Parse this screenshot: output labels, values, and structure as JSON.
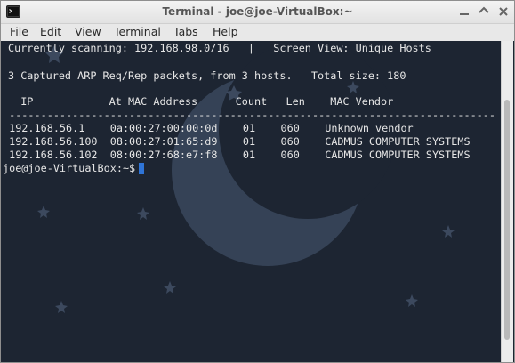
{
  "window": {
    "title": "Terminal - joe@joe-VirtualBox:~"
  },
  "menu": {
    "items": [
      "File",
      "Edit",
      "View",
      "Terminal",
      "Tabs",
      "Help"
    ]
  },
  "terminal": {
    "status_line": "Currently scanning: 192.168.98.0/16   |   Screen View: Unique Hosts",
    "summary_line": "3 Captured ARP Req/Rep packets, from 3 hosts.   Total size: 180",
    "header_line": "  IP            At MAC Address      Count   Len    MAC Vendor",
    "dash_line": " -----------------------------------------------------------------------------",
    "rows": [
      " 192.168.56.1    0a:00:27:00:00:0d    01    060    Unknown vendor",
      " 192.168.56.100  08:00:27:01:65:d9    01    060    CADMUS COMPUTER SYSTEMS",
      " 192.168.56.102  08:00:27:68:e7:f8    01    060    CADMUS COMPUTER SYSTEMS"
    ],
    "prompt": "joe@joe-VirtualBox:~$ "
  },
  "colors": {
    "terminal_bg": "#1d2532",
    "terminal_fg": "#e6e6e6",
    "cursor": "#2f74d6"
  },
  "icons": [
    "terminal-app-icon",
    "minimize-icon",
    "maximize-icon",
    "close-icon"
  ]
}
